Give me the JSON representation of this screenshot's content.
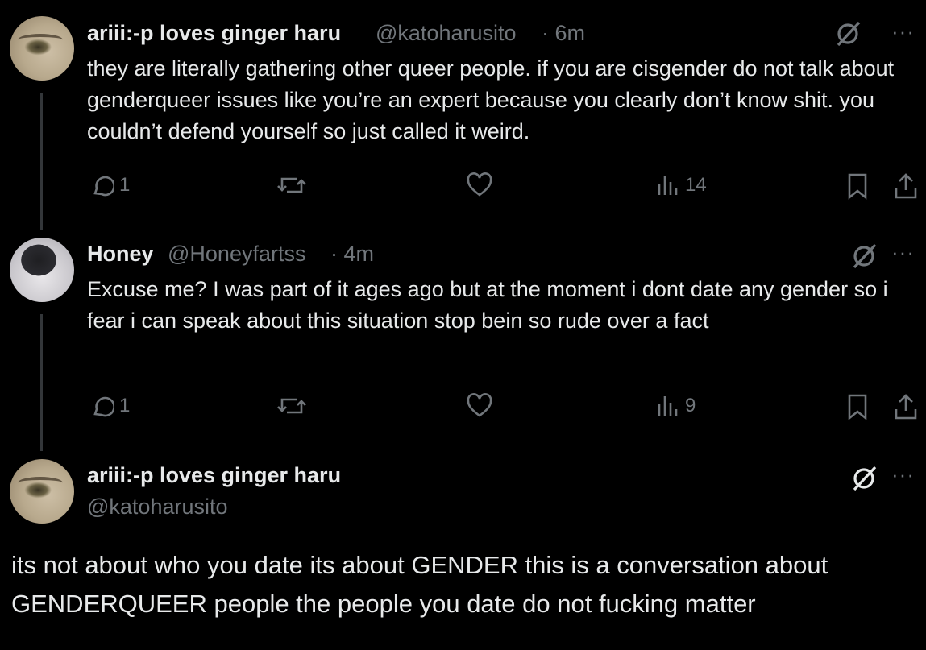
{
  "tweets": [
    {
      "display_name": "ariii:-p loves ginger haru",
      "handle": "@katoharusito",
      "time": "· 6m",
      "text": "they are literally gathering other queer people. if you are cisgender do not talk about genderqueer issues like you’re an expert because you clearly don’t know shit. you couldn’t defend yourself so just called it weird.",
      "replies": "1",
      "views": "14"
    },
    {
      "display_name": "Honey",
      "handle": "@Honeyfartss",
      "time": "· 4m",
      "text": "Excuse me? I was part of it ages ago but at the moment i dont date any gender so i fear i can speak about this situation stop bein so rude over a fact",
      "replies": "1",
      "views": "9"
    },
    {
      "display_name": "ariii:-p loves ginger haru",
      "handle": "@katoharusito",
      "text": "its not about who you date its about GENDER this is a conversation about GENDERQUEER people the people you date do not fucking matter"
    }
  ],
  "icons": {
    "reply": "reply-icon",
    "retweet": "retweet-icon",
    "like": "heart-icon",
    "views": "views-icon",
    "bookmark": "bookmark-icon",
    "share": "share-icon",
    "grok": "grok-icon",
    "more": "more-icon"
  },
  "more_label": "···"
}
